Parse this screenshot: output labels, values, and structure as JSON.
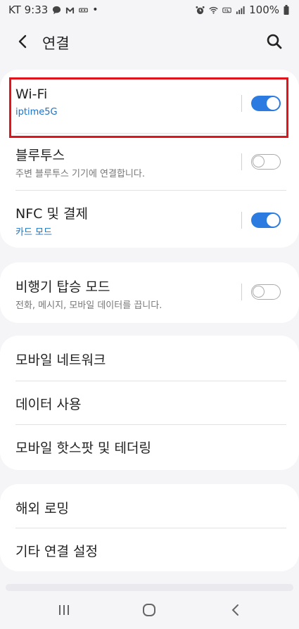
{
  "status_bar": {
    "carrier_time": "KT 9:33",
    "battery": "100%"
  },
  "header": {
    "title": "연결"
  },
  "wifi": {
    "title": "Wi-Fi",
    "subtitle": "iptime5G",
    "enabled": true
  },
  "bluetooth": {
    "title": "블루투스",
    "subtitle": "주변 블루투스 기기에 연결합니다.",
    "enabled": false
  },
  "nfc": {
    "title": "NFC 및 결제",
    "subtitle": "카드 모드",
    "enabled": true
  },
  "airplane": {
    "title": "비행기 탑승 모드",
    "subtitle": "전화, 메시지, 모바일 데이터를 끕니다.",
    "enabled": false
  },
  "menu1": {
    "items": [
      "모바일 네트워크",
      "데이터 사용",
      "모바일 핫스팟 및 테더링"
    ]
  },
  "menu2": {
    "items": [
      "해외 로밍",
      "기타 연결 설정"
    ]
  },
  "colors": {
    "accent": "#2b7be0",
    "sub_blue": "#1a73c8",
    "highlight": "#e0141b"
  }
}
